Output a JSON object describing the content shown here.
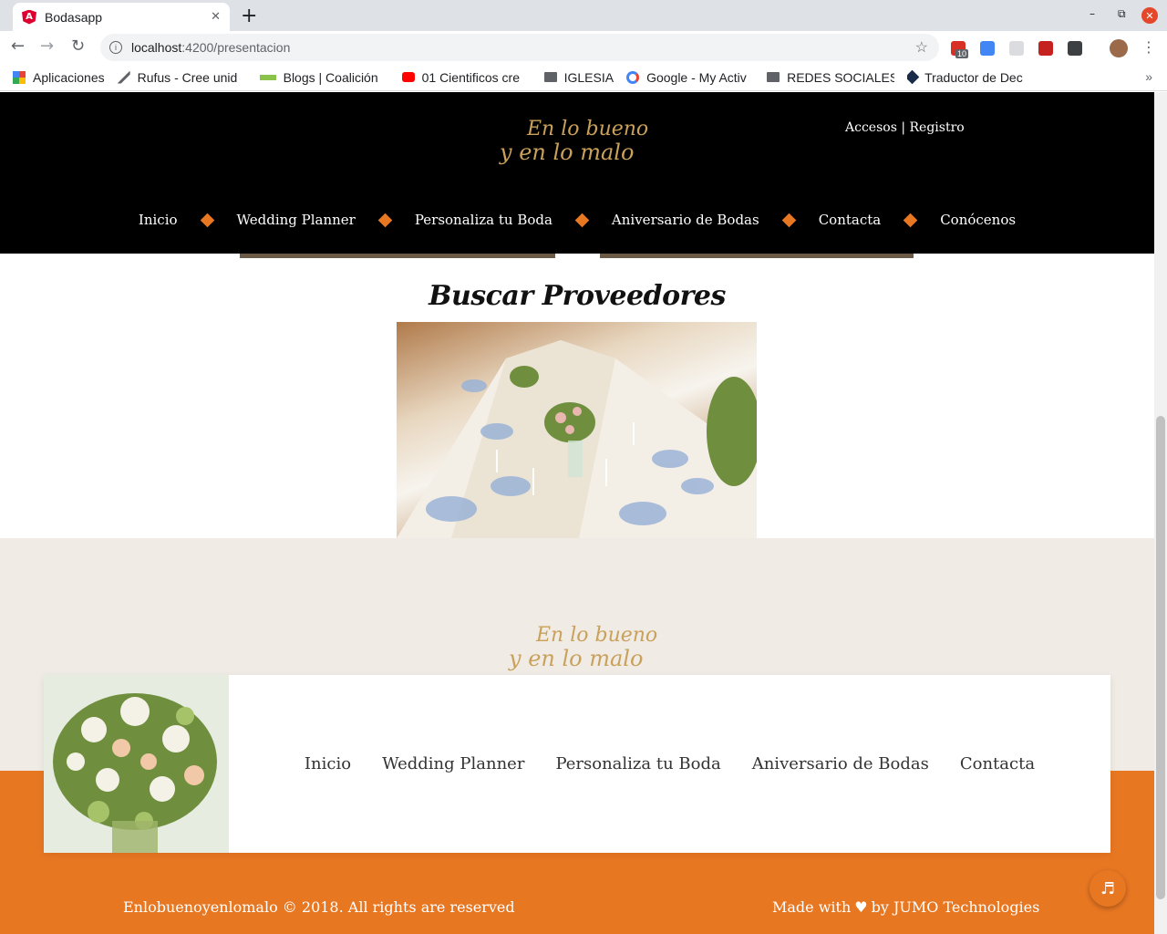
{
  "browser": {
    "tab_title": "Bodasapp",
    "favicon_letter": "A",
    "tab_close": "✕",
    "new_tab": "+",
    "url_host": "localhost",
    "url_path": ":4200/presentacion",
    "bookmarks": [
      {
        "label": "Aplicaciones",
        "icon": "apps-grid-icon"
      },
      {
        "label": "Rufus - Cree unid",
        "icon": "rufus-icon"
      },
      {
        "label": "Blogs | Coalición",
        "icon": "tgc-icon"
      },
      {
        "label": "01 Cientificos cre",
        "icon": "youtube-icon"
      },
      {
        "label": "IGLESIA",
        "icon": "folder-icon"
      },
      {
        "label": "Google - My Activ",
        "icon": "google-icon"
      },
      {
        "label": "REDES SOCIALES",
        "icon": "folder-icon"
      },
      {
        "label": "Traductor de Dec",
        "icon": "translator-icon"
      }
    ],
    "extension_badge": "10",
    "colors": {
      "tab_bar": "#dee1e6",
      "angular_red": "#dd0031",
      "close_red": "#e5472a"
    }
  },
  "site": {
    "logo": {
      "line1": "En lo bueno",
      "line2": "y en lo malo"
    },
    "auth": {
      "login": "Accesos",
      "separator": "|",
      "register": "Registro"
    },
    "nav": [
      "Inicio",
      "Wedding Planner",
      "Personaliza tu Boda",
      "Aniversario de Bodas",
      "Contacta",
      "Conócenos"
    ],
    "section_title": "Buscar Proveedores",
    "footer_nav": [
      "Inicio",
      "Wedding Planner",
      "Personaliza tu Boda",
      "Aniversario de Bodas",
      "Contacta"
    ],
    "copyright": "Enlobuenoyenlomalo © 2018. All rights are reserved",
    "made_with_prefix": "Made with",
    "made_with_suffix": "by JUMO Technologies",
    "colors": {
      "accent": "#e87722",
      "gold": "#c9a15a",
      "header_bg": "#000000",
      "footer_bg": "#f0ebe5"
    }
  }
}
